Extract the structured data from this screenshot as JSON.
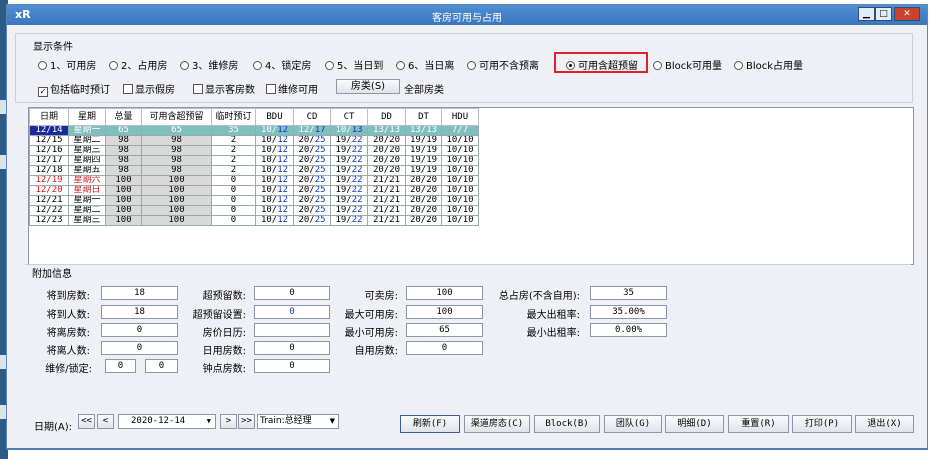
{
  "window": {
    "title": "客房可用与占用",
    "app_icon": "xr-logo-icon"
  },
  "conditions": {
    "title": "显示条件",
    "options": [
      {
        "label": "1、可用房",
        "selected": false
      },
      {
        "label": "2、占用房",
        "selected": false
      },
      {
        "label": "3、维修房",
        "selected": false
      },
      {
        "label": "4、锁定房",
        "selected": false
      },
      {
        "label": "5、当日到",
        "selected": false
      },
      {
        "label": "6、当日离",
        "selected": false
      },
      {
        "label": "可用不含预离",
        "selected": false
      },
      {
        "label": "可用含超预留",
        "selected": true
      },
      {
        "label": "Block可用量",
        "selected": false
      },
      {
        "label": "Block占用量",
        "selected": false
      }
    ],
    "checks": [
      {
        "label": "包括临时预订",
        "checked": true
      },
      {
        "label": "显示假房",
        "checked": false
      },
      {
        "label": "显示客房数",
        "checked": false
      },
      {
        "label": "维修可用",
        "checked": false
      }
    ],
    "room_type_button": "房类(S)",
    "room_type_value": "全部房类"
  },
  "grid": {
    "headers": [
      "日期",
      "星期",
      "总量",
      "可用含超预留",
      "临时预订",
      "BDU",
      "CD",
      "CT",
      "DD",
      "DT",
      "HDU"
    ],
    "rows": [
      {
        "date": "12/14",
        "week": "星期一",
        "total": "65",
        "avail": "65",
        "temp": "35",
        "bdu_a": "10/",
        "bdu_b": "12",
        "cd_a": "12/",
        "cd_b": "17",
        "ct_a": "10/",
        "ct_b": "13",
        "dd": "13/13",
        "dt": "13/13",
        "hdu": "7/7",
        "selected": true,
        "weekend": false
      },
      {
        "date": "12/15",
        "week": "星期二",
        "total": "98",
        "avail": "98",
        "temp": "2",
        "bdu_a": "10/",
        "bdu_b": "12",
        "cd_a": "20/",
        "cd_b": "25",
        "ct_a": "19/",
        "ct_b": "22",
        "dd": "20/20",
        "dt": "19/19",
        "hdu": "10/10",
        "selected": false,
        "weekend": false
      },
      {
        "date": "12/16",
        "week": "星期三",
        "total": "98",
        "avail": "98",
        "temp": "2",
        "bdu_a": "10/",
        "bdu_b": "12",
        "cd_a": "20/",
        "cd_b": "25",
        "ct_a": "19/",
        "ct_b": "22",
        "dd": "20/20",
        "dt": "19/19",
        "hdu": "10/10",
        "selected": false,
        "weekend": false
      },
      {
        "date": "12/17",
        "week": "星期四",
        "total": "98",
        "avail": "98",
        "temp": "2",
        "bdu_a": "10/",
        "bdu_b": "12",
        "cd_a": "20/",
        "cd_b": "25",
        "ct_a": "19/",
        "ct_b": "22",
        "dd": "20/20",
        "dt": "19/19",
        "hdu": "10/10",
        "selected": false,
        "weekend": false
      },
      {
        "date": "12/18",
        "week": "星期五",
        "total": "98",
        "avail": "98",
        "temp": "2",
        "bdu_a": "10/",
        "bdu_b": "12",
        "cd_a": "20/",
        "cd_b": "25",
        "ct_a": "19/",
        "ct_b": "22",
        "dd": "20/20",
        "dt": "19/19",
        "hdu": "10/10",
        "selected": false,
        "weekend": false
      },
      {
        "date": "12/19",
        "week": "星期六",
        "total": "100",
        "avail": "100",
        "temp": "0",
        "bdu_a": "10/",
        "bdu_b": "12",
        "cd_a": "20/",
        "cd_b": "25",
        "ct_a": "19/",
        "ct_b": "22",
        "dd": "21/21",
        "dt": "20/20",
        "hdu": "10/10",
        "selected": false,
        "weekend": true
      },
      {
        "date": "12/20",
        "week": "星期日",
        "total": "100",
        "avail": "100",
        "temp": "0",
        "bdu_a": "10/",
        "bdu_b": "12",
        "cd_a": "20/",
        "cd_b": "25",
        "ct_a": "19/",
        "ct_b": "22",
        "dd": "21/21",
        "dt": "20/20",
        "hdu": "10/10",
        "selected": false,
        "weekend": true
      },
      {
        "date": "12/21",
        "week": "星期一",
        "total": "100",
        "avail": "100",
        "temp": "0",
        "bdu_a": "10/",
        "bdu_b": "12",
        "cd_a": "20/",
        "cd_b": "25",
        "ct_a": "19/",
        "ct_b": "22",
        "dd": "21/21",
        "dt": "20/20",
        "hdu": "10/10",
        "selected": false,
        "weekend": false
      },
      {
        "date": "12/22",
        "week": "星期二",
        "total": "100",
        "avail": "100",
        "temp": "0",
        "bdu_a": "10/",
        "bdu_b": "12",
        "cd_a": "20/",
        "cd_b": "25",
        "ct_a": "19/",
        "ct_b": "22",
        "dd": "21/21",
        "dt": "20/20",
        "hdu": "10/10",
        "selected": false,
        "weekend": false
      },
      {
        "date": "12/23",
        "week": "星期三",
        "total": "100",
        "avail": "100",
        "temp": "0",
        "bdu_a": "10/",
        "bdu_b": "12",
        "cd_a": "20/",
        "cd_b": "25",
        "ct_a": "19/",
        "ct_b": "22",
        "dd": "21/21",
        "dt": "20/20",
        "hdu": "10/10",
        "selected": false,
        "weekend": false
      }
    ]
  },
  "info": {
    "title": "附加信息",
    "arrive_rooms_label": "将到房数:",
    "arrive_rooms": "18",
    "arrive_people_label": "将到人数:",
    "arrive_people": "18",
    "leave_rooms_label": "将离房数:",
    "leave_rooms": "0",
    "leave_people_label": "将离人数:",
    "leave_people": "0",
    "repair_lock_label": "维修/锁定:",
    "repair": "0",
    "lock": "0",
    "over_reserve_label": "超预留数:",
    "over_reserve": "0",
    "over_setting_label": "超预留设置:",
    "over_setting": "0",
    "price_calendar_label": "房价日历:",
    "price_calendar": "",
    "dayuse_label": "日用房数:",
    "dayuse": "0",
    "hourly_label": "钟点房数:",
    "hourly": "0",
    "sellable_label": "可卖房:",
    "sellable": "100",
    "max_avail_label": "最大可用房:",
    "max_avail": "100",
    "min_avail_label": "最小可用房:",
    "min_avail": "65",
    "self_use_label": "自用房数:",
    "self_use": "0",
    "total_occ_label": "总占房(不含自用):",
    "total_occ": "35",
    "max_rate_label": "最大出租率:",
    "max_rate": "35.00%",
    "min_rate_label": "最小出租率:",
    "min_rate": "0.00%"
  },
  "footer": {
    "date_label": "日期(A):",
    "date_value": "2020-12-14",
    "train_value": "Train:总经理",
    "buttons": {
      "refresh": "刷新(F)",
      "channel": "渠道房态(C)",
      "block": "Block(B)",
      "group": "团队(G)",
      "detail": "明细(D)",
      "reset": "重置(R)",
      "print": "打印(P)",
      "exit": "退出(X)"
    }
  }
}
